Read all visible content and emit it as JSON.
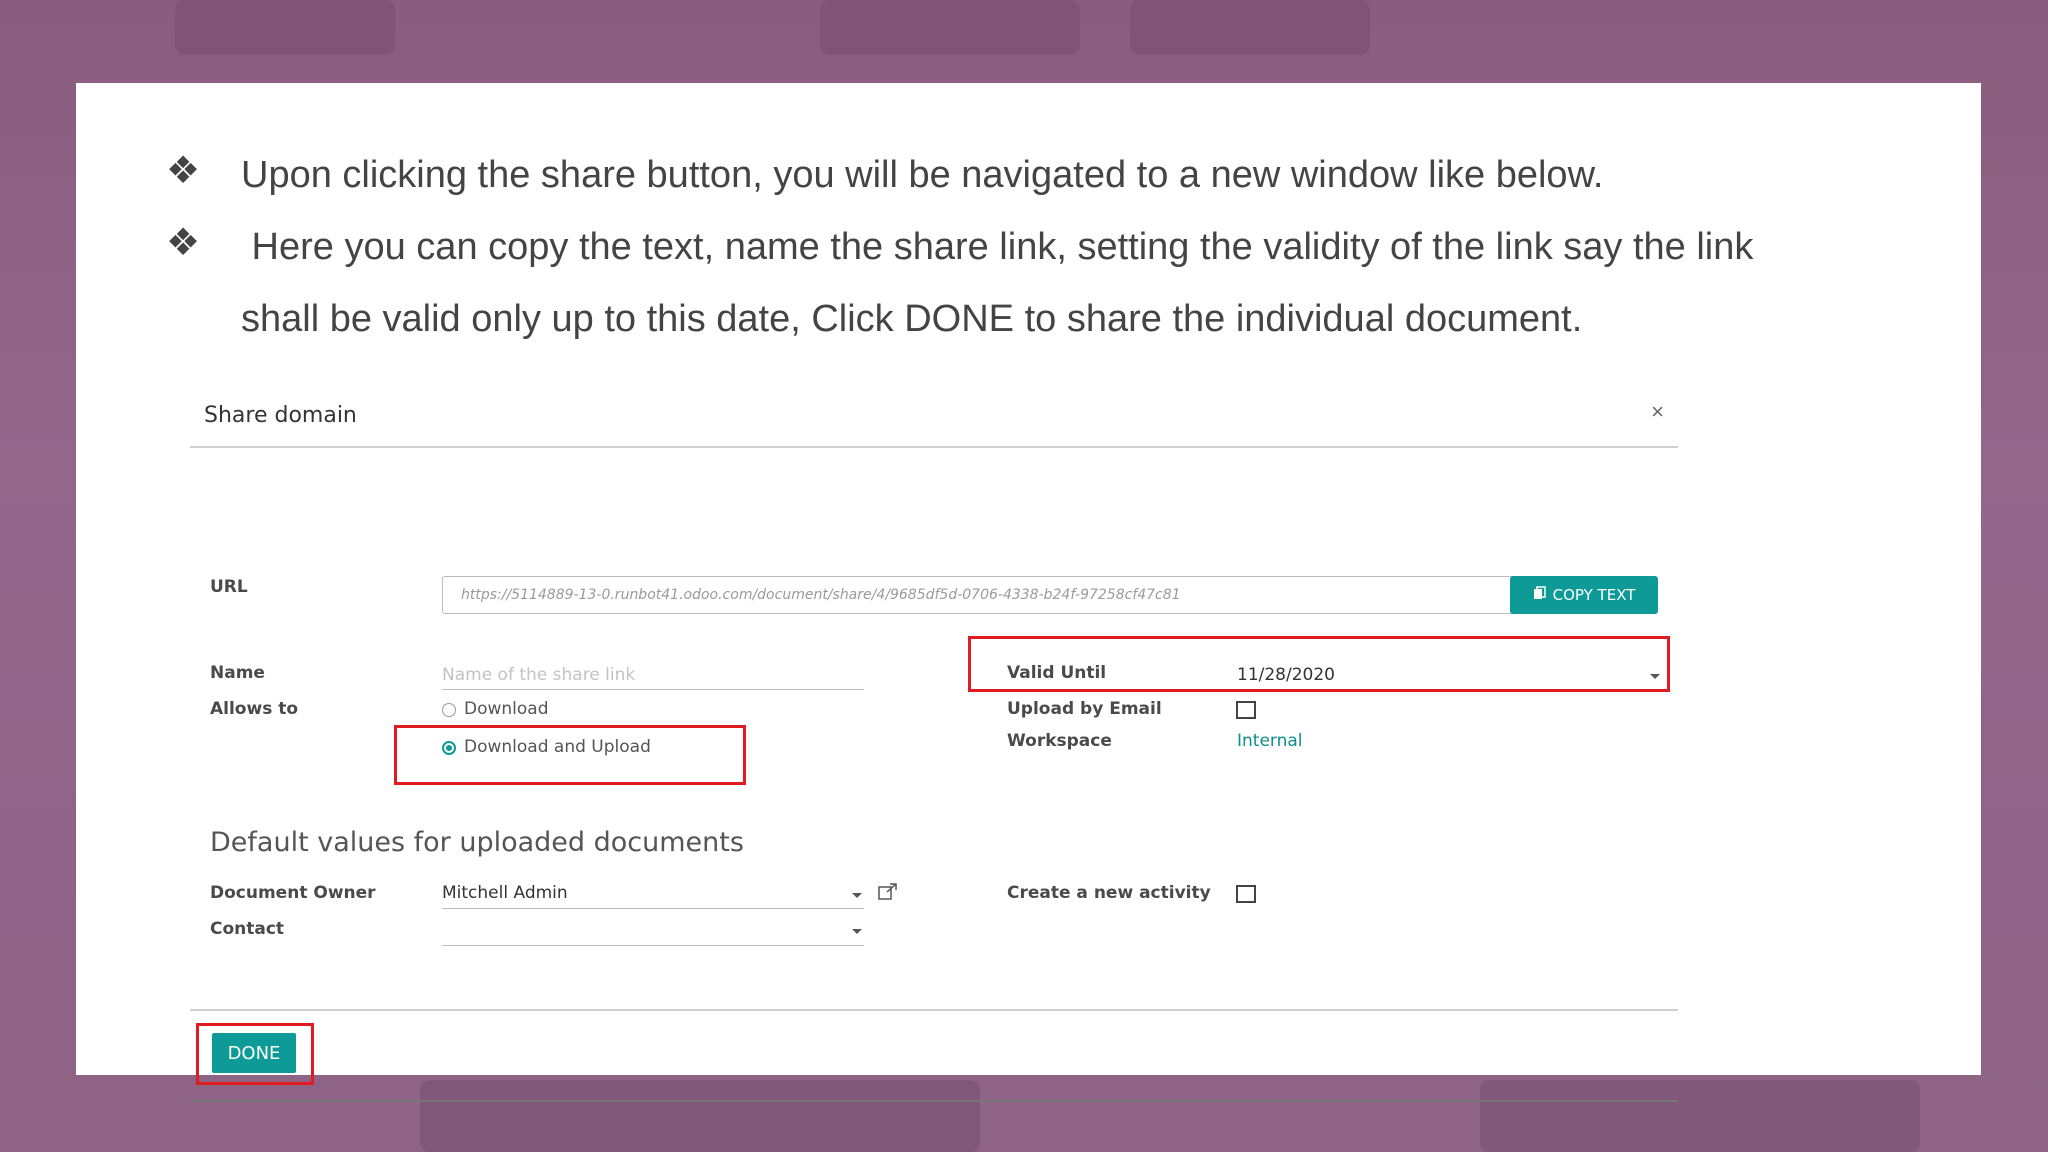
{
  "slide": {
    "bullet_symbol": "❖",
    "bullets": [
      "Upon clicking the share button, you will be navigated to a new window like below.",
      " Here you can copy the text, name the share link, setting the validity of the link say the link",
      "shall be valid only up to this date, Click DONE to share the individual document."
    ]
  },
  "dialog": {
    "title": "Share domain",
    "close_icon": "×",
    "url_label": "URL",
    "url_value": "https://5114889-13-0.runbot41.odoo.com/document/share/4/9685df5d-0706-4338-b24f-97258cf47c81",
    "copy_button": "COPY TEXT",
    "name_label": "Name",
    "name_placeholder": "Name of the share link",
    "allows_label": "Allows to",
    "allows_options": [
      "Download",
      "Download and Upload"
    ],
    "allows_selected": "Download and Upload",
    "valid_until_label": "Valid Until",
    "valid_until_value": "11/28/2020",
    "upload_email_label": "Upload by Email",
    "upload_email_checked": false,
    "workspace_label": "Workspace",
    "workspace_value": "Internal",
    "section_title": "Default values for uploaded documents",
    "owner_label": "Document Owner",
    "owner_value": "Mitchell Admin",
    "contact_label": "Contact",
    "contact_value": "",
    "activity_label": "Create a new activity",
    "activity_checked": false,
    "done_button": "DONE"
  },
  "colors": {
    "accent": "#0e9a96",
    "highlight": "#e01c22",
    "background": "#8e6386"
  }
}
